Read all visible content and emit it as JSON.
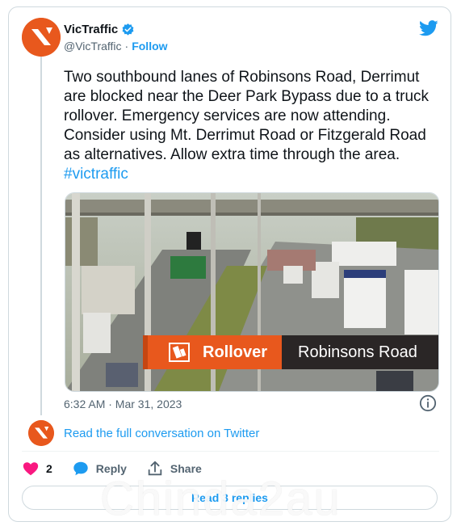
{
  "account": {
    "display_name": "VicTraffic",
    "handle": "@VicTraffic",
    "separator": "·",
    "follow_label": "Follow"
  },
  "tweet": {
    "text": "Two southbound lanes of Robinsons Road, Derrimut are blocked near the Deer Park Bypass due to a truck rollover. Emergency services are now attending. Consider using Mt. Derrimut Road or Fitzgerald Road as alternatives. Allow extra time through the area.",
    "hashtag": "#victraffic",
    "timestamp": "6:32 AM · Mar 31, 2023"
  },
  "media": {
    "banner_tag": "Rollover",
    "banner_location": "Robinsons Road"
  },
  "conversation": {
    "read_link": "Read the full conversation on Twitter"
  },
  "actions": {
    "like_count": "2",
    "reply_label": "Reply",
    "share_label": "Share"
  },
  "read_replies_label": "Read 3 replies",
  "watermark": "Chinda2au",
  "colors": {
    "brand_orange": "#e8581d",
    "twitter_blue": "#1d9bf0",
    "like_pink": "#f91880"
  },
  "icons": [
    "verified-badge-icon",
    "twitter-bird-icon",
    "info-icon",
    "heart-icon",
    "reply-bubble-icon",
    "share-icon",
    "victraffic-logo"
  ]
}
